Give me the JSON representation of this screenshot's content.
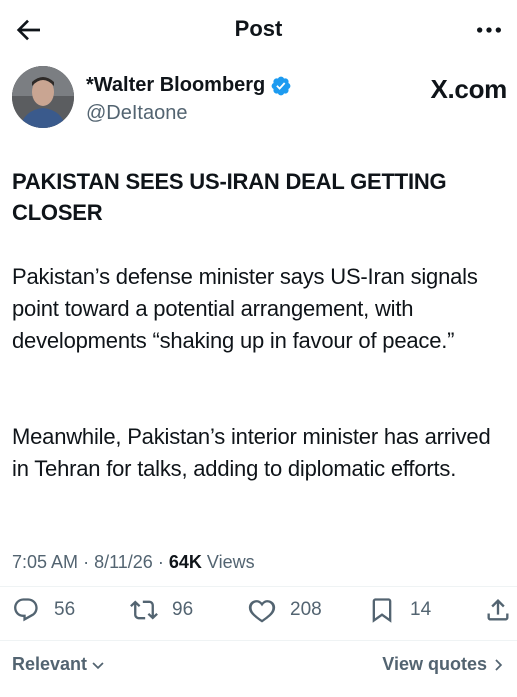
{
  "header": {
    "title": "Post",
    "back_icon": "arrow-left-icon",
    "more_icon": "more-horizontal-icon"
  },
  "author": {
    "display_name": "*Walter Bloomberg",
    "handle": "@DeItaone",
    "verified_color": "#1d9bf0",
    "brand": "X.com"
  },
  "post": {
    "headline": "PAKISTAN SEES US-IRAN DEAL GETTING CLOSER",
    "paragraph1": "Pakistan’s defense minister says US-Iran signals point toward a potential arrangement, with developments “shaking up in favour of peace.”",
    "paragraph2": "Meanwhile, Pakistan’s interior minister has arrived in Tehran for talks, adding to diplomatic efforts."
  },
  "meta": {
    "time": "7:05 AM",
    "date": "8/11/26",
    "views_count": "64K",
    "views_label": "Views",
    "separator": "·"
  },
  "actions": {
    "replies": "56",
    "reposts": "96",
    "likes": "208",
    "bookmarks": "14"
  },
  "footer": {
    "sort_label": "Relevant",
    "view_quotes_label": "View quotes"
  },
  "colors": {
    "text": "#0f1419",
    "secondary": "#536471",
    "accent": "#1d9bf0"
  }
}
